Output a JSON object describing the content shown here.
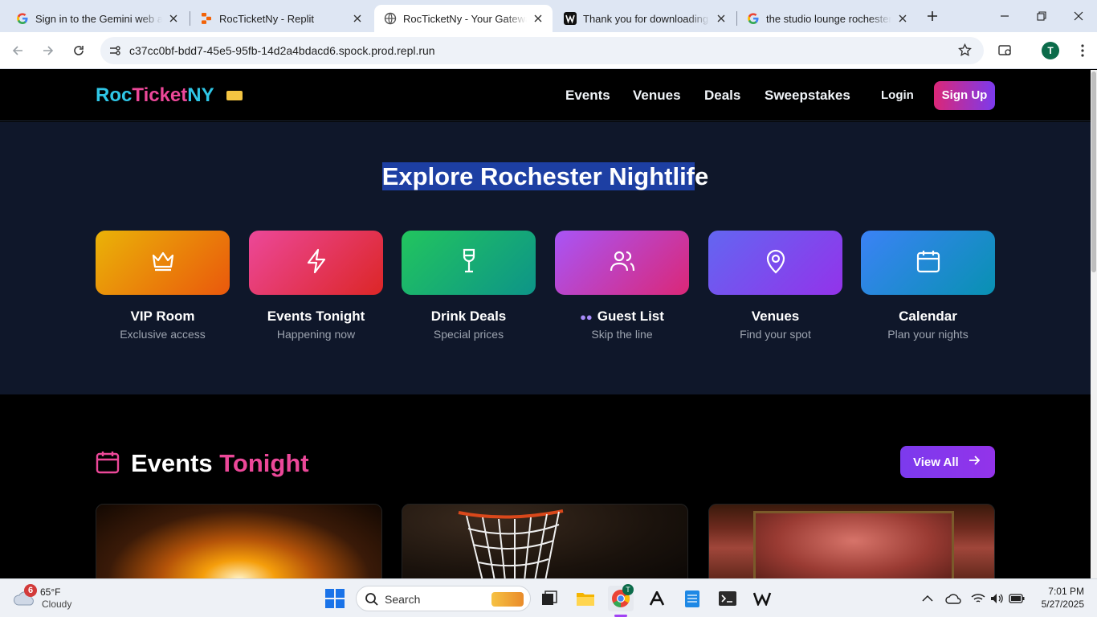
{
  "browser": {
    "tabs": [
      {
        "title": "Sign in to the Gemini web ap"
      },
      {
        "title": "RocTicketNy - Replit"
      },
      {
        "title": "RocTicketNy - Your Gateway t"
      },
      {
        "title": "Thank you for downloading V"
      },
      {
        "title": "the studio lounge rochester n"
      }
    ],
    "url": "c37cc0bf-bdd7-45e5-95fb-14d2a4bdacd6.spock.prod.repl.run",
    "profile_initial": "T"
  },
  "site": {
    "logo_part1": "Roc",
    "logo_part2": "Ticket",
    "logo_part3": "NY",
    "nav": [
      "Events",
      "Venues",
      "Deals",
      "Sweepstakes"
    ],
    "login": "Login",
    "signup": "Sign Up",
    "hero_title_highlight": "Explore Rochester Nightlif",
    "hero_title_rest": "e",
    "categories": [
      {
        "label": "VIP Room",
        "sub": "Exclusive access",
        "icon": "crown-icon"
      },
      {
        "label": "Events Tonight",
        "sub": "Happening now",
        "icon": "lightning-icon"
      },
      {
        "label": "Drink Deals",
        "sub": "Special prices",
        "icon": "wine-glass-icon"
      },
      {
        "label": "Guest List",
        "sub": "Skip the line",
        "icon": "users-icon"
      },
      {
        "label": "Venues",
        "sub": "Find your spot",
        "icon": "map-pin-icon"
      },
      {
        "label": "Calendar",
        "sub": "Plan your nights",
        "icon": "calendar-icon"
      }
    ],
    "section_title_a": "Events",
    "section_title_b": "Tonight",
    "view_all": "View All"
  },
  "taskbar": {
    "weather_temp": "65°F",
    "weather_desc": "Cloudy",
    "weather_badge": "6",
    "search_placeholder": "Search",
    "time": "7:01 PM",
    "date": "5/27/2025"
  },
  "colors": {
    "cyan": "#2fc6e6",
    "pink": "#ec4899",
    "purple": "#7c3aed",
    "hero_bg": "#0f172a"
  }
}
